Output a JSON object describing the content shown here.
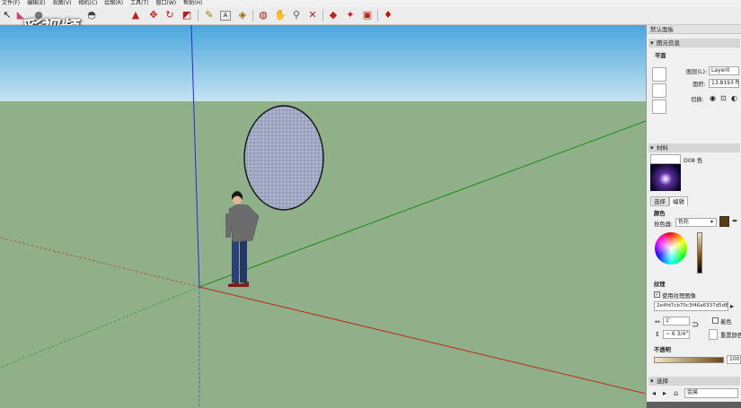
{
  "menu": [
    "文件(F)",
    "编辑(E)",
    "视图(V)",
    "相机(C)",
    "绘图(R)",
    "工具(T)",
    "窗口(W)",
    "帮助(H)"
  ],
  "watermark": "彩视频",
  "toolbar_icons": [
    "select-icon",
    "eraser-icon",
    "paint-bucket-icon",
    "move-icon",
    "rotate-icon",
    "scale-icon",
    "push-pull-icon",
    "tape-measure-icon",
    "text-icon",
    "3d-text-icon",
    "orbit-icon",
    "pan-icon",
    "zoom-extents-icon",
    "warehouse-icon",
    "share-icon",
    "extension-icon",
    "ruby-icon"
  ],
  "panel": {
    "title": "默认面板",
    "entity_info": {
      "header": "图元信息",
      "type": "平面",
      "layer_label": "图层(L):",
      "layer_value": "Layer0",
      "area_label": "面积:",
      "area_value": "13.8193 ft²",
      "toggle_label": "切换:"
    },
    "materials": {
      "header": "材料",
      "name": "D08 色",
      "tab_select": "选择",
      "tab_edit": "编辑",
      "color_section": "颜色",
      "picker_label": "拾色器:",
      "picker_value": "色轮",
      "swatch_color": "#5a3a10",
      "texture_section": "纹理",
      "use_texture_label": "使用纹理图像",
      "texture_file": "2e4fd7cb70c3f46a6337d5d850",
      "width_value": "1'",
      "height_value": "~ 6 3/4\"",
      "colorize_label": "着色",
      "reset_label": "重置颜色",
      "opacity_label": "不透明",
      "opacity_value": "100"
    },
    "select_section": {
      "header": "选择",
      "collection_value": "金属"
    }
  },
  "colors": {
    "sky_top": "#48a6dc",
    "sky_bottom": "#c6e3f1",
    "ground": "#8fb088",
    "axis_blue": "#2a2ad0",
    "axis_green": "#1f8a1f",
    "axis_red": "#c0281e",
    "circle_fill": "#9fa9c4"
  }
}
